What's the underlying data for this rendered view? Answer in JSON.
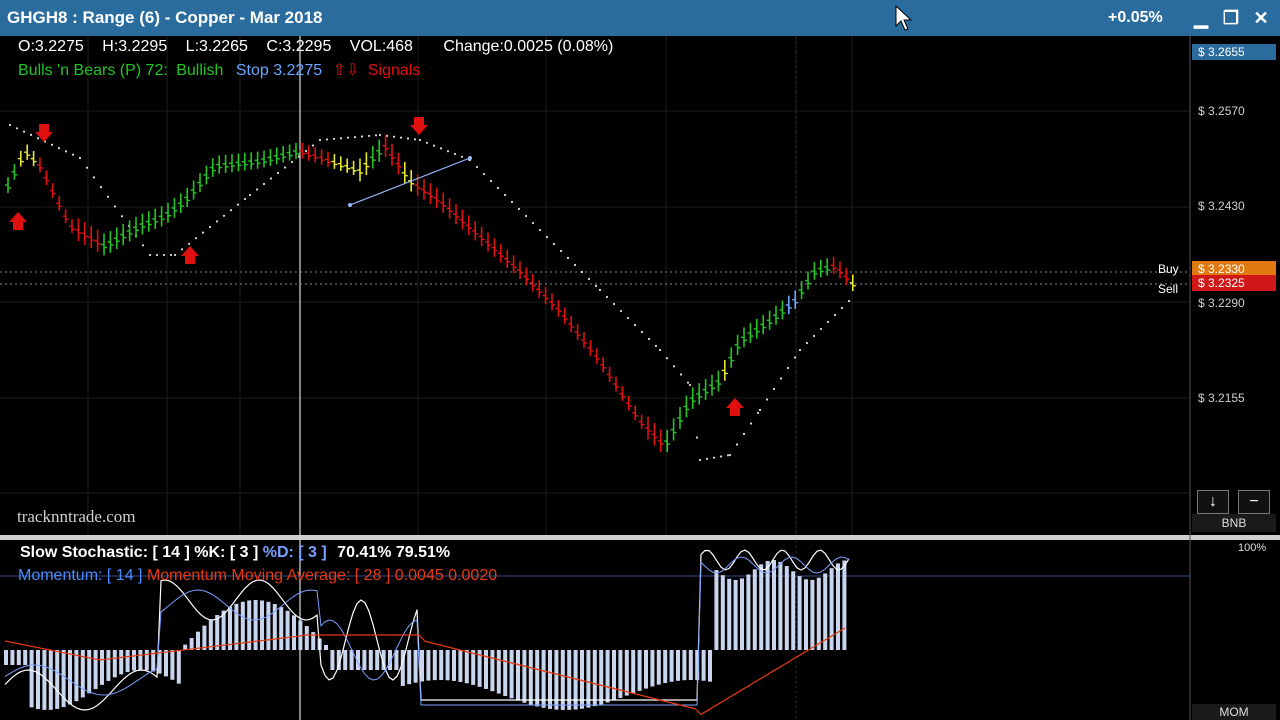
{
  "window": {
    "title": "GHGH8 : Range (6)  -  Copper - Mar 2018",
    "change_pct": "+0.05%",
    "minimize_icon": "▁",
    "restore_icon": "❐",
    "close_icon": "✕"
  },
  "ohlc": {
    "open": "O:3.2275",
    "high": "H:3.2295",
    "low": "L:3.2265",
    "close": "C:3.2295",
    "volume": "VOL:468",
    "change": "Change:0.0025 (0.08%)"
  },
  "indicator": {
    "name": "Bulls 'n Bears (P) 72:",
    "state": "Bullish",
    "stop": "Stop 3.2275",
    "arrows": "⇧⇩",
    "signals": "Signals"
  },
  "watermark": "tracknntrade.com",
  "price_axis": {
    "current": "$ 3.2655",
    "labels": [
      "$ 3.2570",
      "$ 3.2430",
      "$ 3.2290",
      "$ 3.2155"
    ],
    "buy_label": "Buy",
    "sell_label": "Sell",
    "buy_price": "$ 3.2330",
    "sell_price": "$ 3.2325",
    "scroll_down_icon": "↓",
    "collapse_icon": "−",
    "bnb_tag": "BNB"
  },
  "lower_panel": {
    "stoch_name": "Slow Stochastic: [ 14 ]",
    "stoch_k": "%K: [ 3 ]",
    "stoch_d": "%D: [ 3 ]",
    "stoch_values": "70.41%  79.51%",
    "momentum": "Momentum: [ 14 ]",
    "momentum_ma": "Momentum Moving Average: [ 28 ]",
    "momentum_values": "0.0045  0.0020",
    "hundred_label": "100%",
    "mom_tag": "MOM"
  },
  "colors": {
    "titlebar": "#2b6c9e",
    "bull": "#22c422",
    "bear": "#e01010",
    "neutral": "#e8e830",
    "stop": "#6aa6ff",
    "buy_tag": "#e07a10",
    "sell_tag": "#d01818"
  }
}
